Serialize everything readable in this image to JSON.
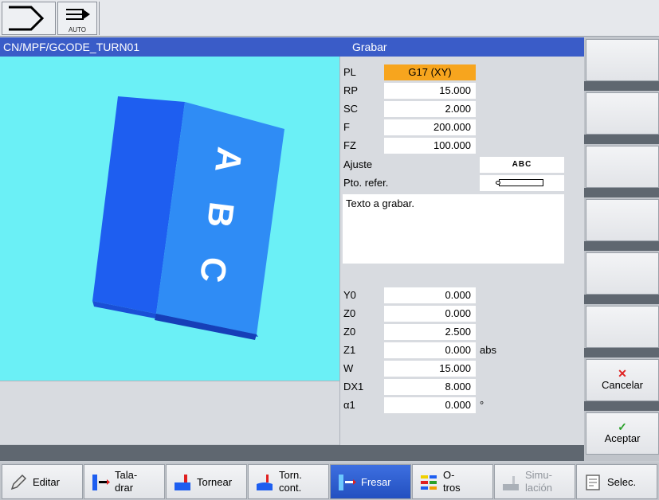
{
  "top": {
    "auto_label": "AUTO"
  },
  "header": {
    "path": "CN/MPF/GCODE_TURN01",
    "title": "Grabar"
  },
  "graphic": {
    "letters": [
      "A",
      "B",
      "C"
    ]
  },
  "form": {
    "top_rows": [
      {
        "label": "PL",
        "value": "G17 (XY)",
        "selected": true
      },
      {
        "label": "RP",
        "value": "15.000"
      },
      {
        "label": "SC",
        "value": "2.000"
      },
      {
        "label": "F",
        "value": "200.000"
      },
      {
        "label": "FZ",
        "value": "100.000"
      }
    ],
    "ajuste_label": "Ajuste",
    "ajuste_value": "ABC",
    "ptoref_label": "Pto. refer.",
    "texto": "Texto a grabar.",
    "bottom_rows": [
      {
        "label": "Y0",
        "value": "0.000",
        "unit": ""
      },
      {
        "label": "Z0",
        "value": "0.000",
        "unit": ""
      },
      {
        "label": "Z0",
        "value": "2.500",
        "unit": ""
      },
      {
        "label": "Z1",
        "value": "0.000",
        "unit": "abs"
      },
      {
        "label": "W",
        "value": "15.000",
        "unit": ""
      },
      {
        "label": "DX1",
        "value": "8.000",
        "unit": ""
      },
      {
        "label": "α1",
        "value": "0.000",
        "unit": "°"
      }
    ]
  },
  "vkeys": {
    "cancel": "Cancelar",
    "accept": "Aceptar",
    "cancel_color": "#e02020",
    "accept_color": "#28a028"
  },
  "hkeys": [
    {
      "label": "Editar",
      "icon": "pencil-icon"
    },
    {
      "label": "Tala-\ndrar",
      "icon": "drill-icon"
    },
    {
      "label": "Tornear",
      "icon": "turning-icon"
    },
    {
      "label": "Torn.\ncont.",
      "icon": "contour-turning-icon"
    },
    {
      "label": "Fresar",
      "icon": "milling-icon",
      "active": true
    },
    {
      "label": "O-\ntros",
      "icon": "others-icon"
    },
    {
      "label": "Simu-\nlación",
      "icon": "simulation-icon",
      "disabled": true
    },
    {
      "label": "Selec.",
      "icon": "select-icon"
    }
  ],
  "colors": {
    "accent": "#3a5cc8",
    "highlight": "#f7a51e",
    "graphic_bg": "#6bf0f6",
    "block_dark": "#1e5ef0",
    "block_light": "#2f8cf5"
  }
}
